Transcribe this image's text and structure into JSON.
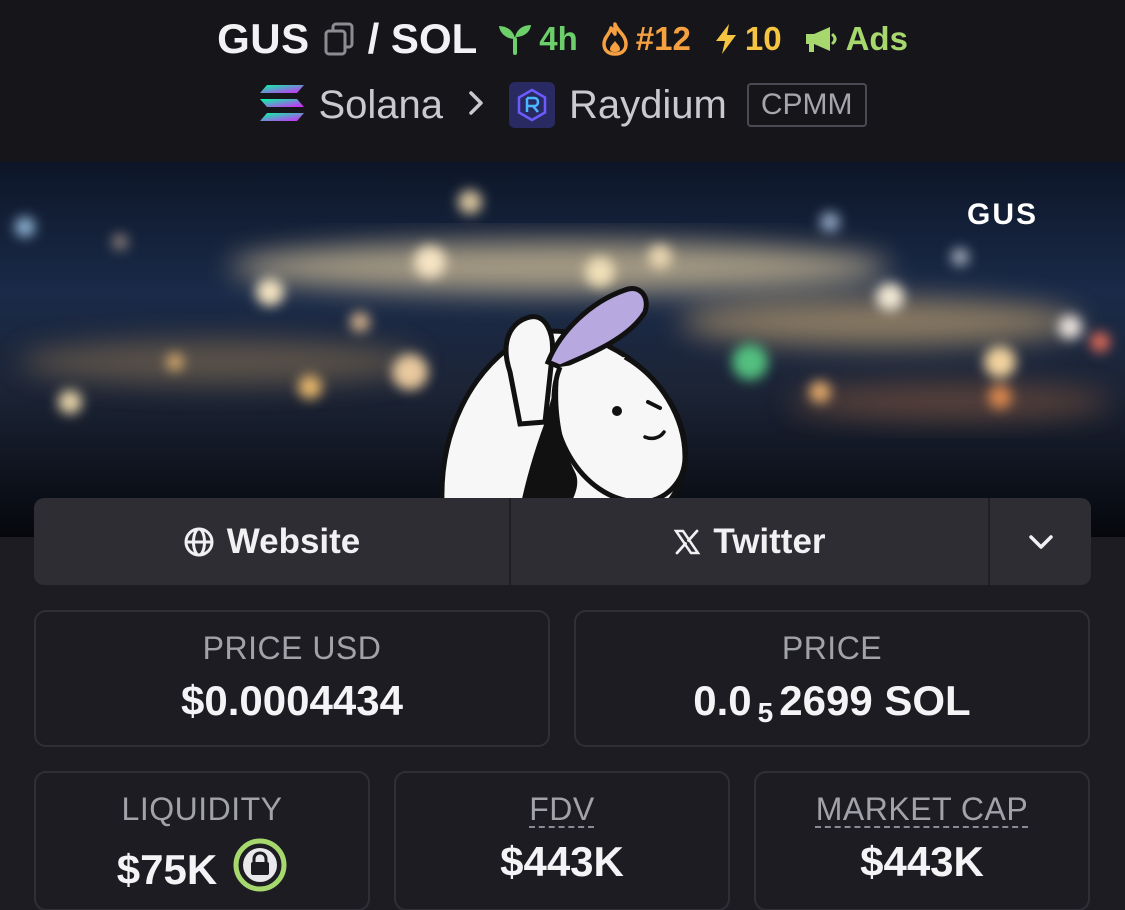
{
  "header": {
    "base_symbol": "GUS",
    "quote_symbol": "/ SOL",
    "badges": {
      "age": "4h",
      "trending_rank": "#12",
      "boosts": "10",
      "ads": "Ads"
    },
    "chain": "Solana",
    "dex": "Raydium",
    "pool_type": "CPMM"
  },
  "banner": {
    "watermark_text": "GUS"
  },
  "links": {
    "website_label": "Website",
    "twitter_label": "Twitter"
  },
  "stats": {
    "price_usd": {
      "label": "PRICE USD",
      "value": "$0.0004434"
    },
    "price_native": {
      "label": "PRICE",
      "value_prefix": "0.0",
      "zero_count": "5",
      "value_suffix": "2699 SOL"
    },
    "liquidity": {
      "label": "LIQUIDITY",
      "value": "$75K"
    },
    "fdv": {
      "label": "FDV",
      "value": "$443K"
    },
    "market_cap": {
      "label": "MARKET CAP",
      "value": "$443K"
    }
  },
  "colors": {
    "background": "#1c1c22",
    "header_bg": "#16161a",
    "age_green": "#6ccf6a",
    "trend_orange": "#f5a142",
    "boost_yellow": "#f5c542",
    "ads_green": "#a6d86e",
    "lock_green": "#a6d86e"
  },
  "icons": [
    "copy-icon",
    "seedling-icon",
    "flame-icon",
    "bolt-icon",
    "megaphone-icon",
    "solana-logo",
    "raydium-logo",
    "chevron-right-icon",
    "globe-icon",
    "x-logo-icon",
    "chevron-down-icon",
    "lock-icon"
  ]
}
